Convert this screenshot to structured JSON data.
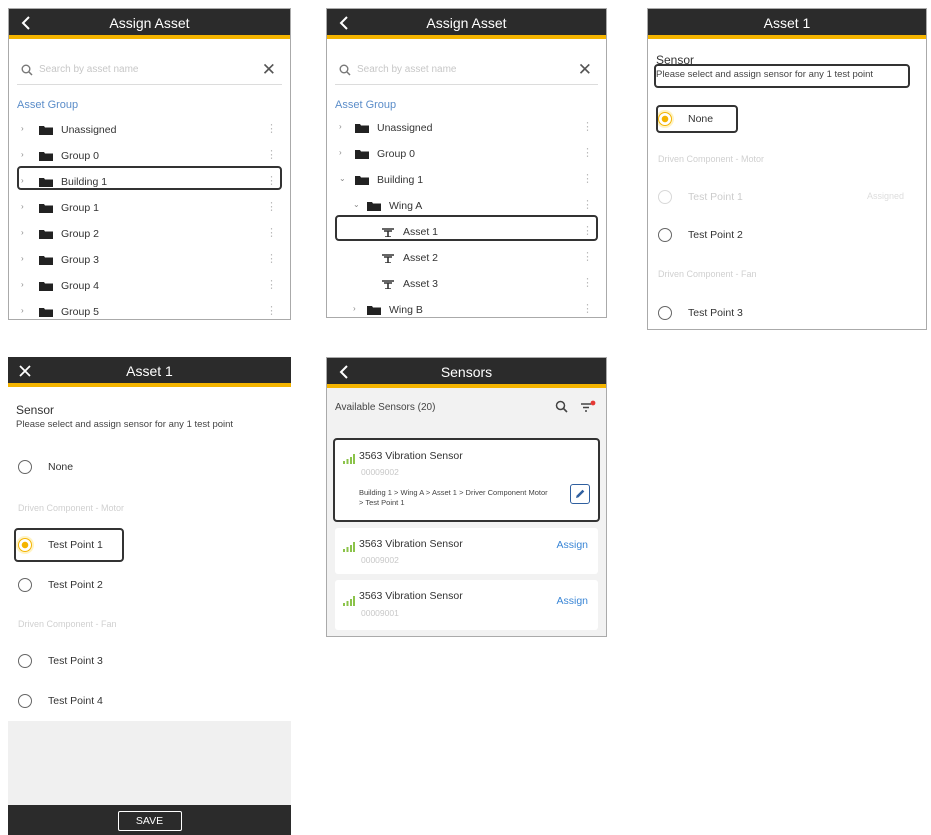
{
  "colors": {
    "header_bg": "#2b2b2b",
    "accent": "#f4b400",
    "link": "#3a86d6",
    "group_label": "#5b8dc9"
  },
  "screen1": {
    "title": "Assign Asset",
    "search_placeholder": "Search by asset name",
    "group_label": "Asset Group",
    "rows": [
      {
        "label": "Unassigned"
      },
      {
        "label": "Group 0"
      },
      {
        "label": "Building 1"
      },
      {
        "label": "Group 1"
      },
      {
        "label": "Group 2"
      },
      {
        "label": "Group 3"
      },
      {
        "label": "Group 4"
      },
      {
        "label": "Group 5"
      }
    ]
  },
  "screen2": {
    "title": "Assign Asset",
    "search_placeholder": "Search by asset name",
    "group_label": "Asset Group",
    "rows": [
      {
        "label": "Unassigned"
      },
      {
        "label": "Group 0"
      },
      {
        "label": "Building 1"
      },
      {
        "label": "Wing A"
      },
      {
        "label": "Asset 1"
      },
      {
        "label": "Asset 2"
      },
      {
        "label": "Asset 3"
      },
      {
        "label": "Wing B"
      }
    ]
  },
  "screen3": {
    "title": "Asset 1",
    "sensor_title": "Sensor",
    "sensor_sub": "Please select and assign sensor for any 1 test point",
    "options": [
      {
        "label": "None"
      },
      {
        "label": "Test Point 1"
      },
      {
        "label": "Test Point 2"
      },
      {
        "label": "Test Point 3"
      }
    ],
    "categories": [
      "Driven Component - Motor",
      "Driven Component - Fan"
    ],
    "tp1_extra": "Assigned"
  },
  "screen4": {
    "title": "Asset 1",
    "sensor_title": "Sensor",
    "sensor_sub": "Please select and assign sensor for any 1 test point",
    "options": [
      {
        "label": "None"
      },
      {
        "label": "Test Point 1"
      },
      {
        "label": "Test Point 2"
      },
      {
        "label": "Test Point 3"
      },
      {
        "label": "Test Point 4"
      }
    ],
    "categories": [
      "Driven Component - Motor",
      "Driven Component - Fan"
    ],
    "save_label": "SAVE"
  },
  "screen5": {
    "title": "Sensors",
    "available": "Available Sensors (20)",
    "cards": [
      {
        "name": "3563 Vibration Sensor",
        "serial": "00009002",
        "path": "Building 1 > Wing A > Asset 1 > Driver Component Motor > Test Point 1"
      },
      {
        "name": "3563 Vibration Sensor",
        "serial": "00009002",
        "action": "Assign"
      },
      {
        "name": "3563 Vibration Sensor",
        "serial": "00009001",
        "action": "Assign"
      }
    ]
  }
}
